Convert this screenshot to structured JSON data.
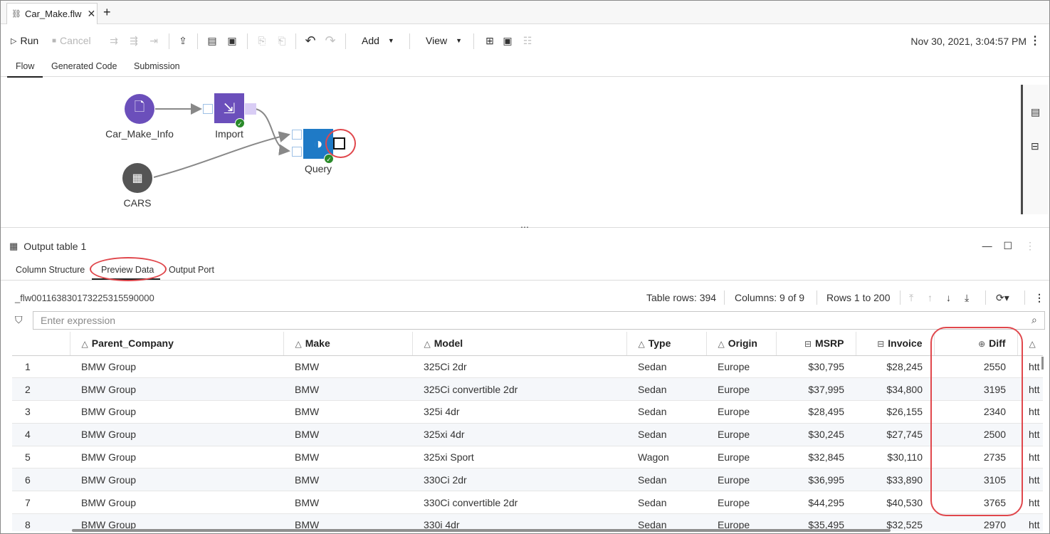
{
  "tab": {
    "title": "Car_Make.flw",
    "close": "✕",
    "add": "+"
  },
  "toolbar": {
    "run": "Run",
    "cancel": "Cancel",
    "add": "Add",
    "view": "View",
    "datetime": "Nov 30, 2021, 3:04:57 PM"
  },
  "subtabs": [
    "Flow",
    "Generated Code",
    "Submission"
  ],
  "flow": {
    "nodes": {
      "car_make_info": "Car_Make_Info",
      "import": "Import",
      "cars": "CARS",
      "query": "Query"
    }
  },
  "output": {
    "title": "Output table 1",
    "tabs": [
      "Column Structure",
      "Preview Data",
      "Output Port"
    ],
    "table_name": "_flw001163830173225315590000",
    "table_rows": "Table rows: 394",
    "columns": "Columns: 9 of 9",
    "rows_range": "Rows 1 to 200",
    "filter_placeholder": "Enter expression"
  },
  "grid": {
    "headers": [
      "",
      "Parent_Company",
      "Make",
      "Model",
      "Type",
      "Origin",
      "MSRP",
      "Invoice",
      "Diff",
      ""
    ],
    "rows": [
      [
        "1",
        "BMW Group",
        "BMW",
        "325Ci 2dr",
        "Sedan",
        "Europe",
        "$30,795",
        "$28,245",
        "2550",
        "htt"
      ],
      [
        "2",
        "BMW Group",
        "BMW",
        "325Ci convertible 2dr",
        "Sedan",
        "Europe",
        "$37,995",
        "$34,800",
        "3195",
        "htt"
      ],
      [
        "3",
        "BMW Group",
        "BMW",
        "325i 4dr",
        "Sedan",
        "Europe",
        "$28,495",
        "$26,155",
        "2340",
        "htt"
      ],
      [
        "4",
        "BMW Group",
        "BMW",
        "325xi 4dr",
        "Sedan",
        "Europe",
        "$30,245",
        "$27,745",
        "2500",
        "htt"
      ],
      [
        "5",
        "BMW Group",
        "BMW",
        "325xi Sport",
        "Wagon",
        "Europe",
        "$32,845",
        "$30,110",
        "2735",
        "htt"
      ],
      [
        "6",
        "BMW Group",
        "BMW",
        "330Ci 2dr",
        "Sedan",
        "Europe",
        "$36,995",
        "$33,890",
        "3105",
        "htt"
      ],
      [
        "7",
        "BMW Group",
        "BMW",
        "330Ci convertible 2dr",
        "Sedan",
        "Europe",
        "$44,295",
        "$40,530",
        "3765",
        "htt"
      ],
      [
        "8",
        "BMW Group",
        "BMW",
        "330i 4dr",
        "Sedan",
        "Europe",
        "$35,495",
        "$32,525",
        "2970",
        "htt"
      ]
    ]
  },
  "colors": {
    "accent_purple": "#6b4fbb",
    "query_blue": "#1f7ac6",
    "highlight_red": "#e0474c",
    "cars_gray": "#555555"
  }
}
